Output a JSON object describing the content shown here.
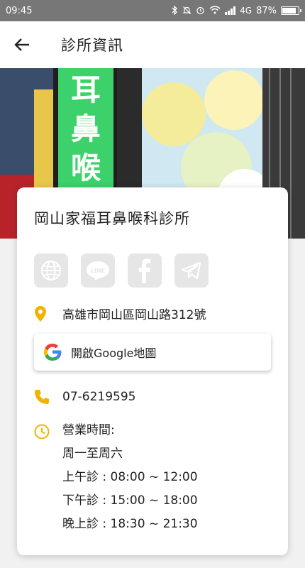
{
  "status": {
    "time": "09:45",
    "network": "4G",
    "battery": "87%",
    "battery_level": 0.87
  },
  "header": {
    "title": "診所資訊"
  },
  "clinic": {
    "name": "岡山家福耳鼻喉科診所",
    "social": [
      {
        "icon": "globe-icon"
      },
      {
        "icon": "line-icon",
        "text": "LINE"
      },
      {
        "icon": "facebook-icon"
      },
      {
        "icon": "telegram-icon"
      }
    ],
    "address": "高雄市岡山區岡山路312號",
    "map_button": "開啟Google地圖",
    "phone": "07-6219595",
    "hours": {
      "label": "營業時間:",
      "days": "周一至周六",
      "morning": "上午診 : 08:00 ~ 12:00",
      "afternoon": "下午診 : 15:00 ~ 18:00",
      "evening": "晚上診 : 18:30 ~ 21:30"
    }
  },
  "colors": {
    "accent": "#f0b400",
    "icon_gray": "#ffffff",
    "status_bar": "#777777"
  }
}
